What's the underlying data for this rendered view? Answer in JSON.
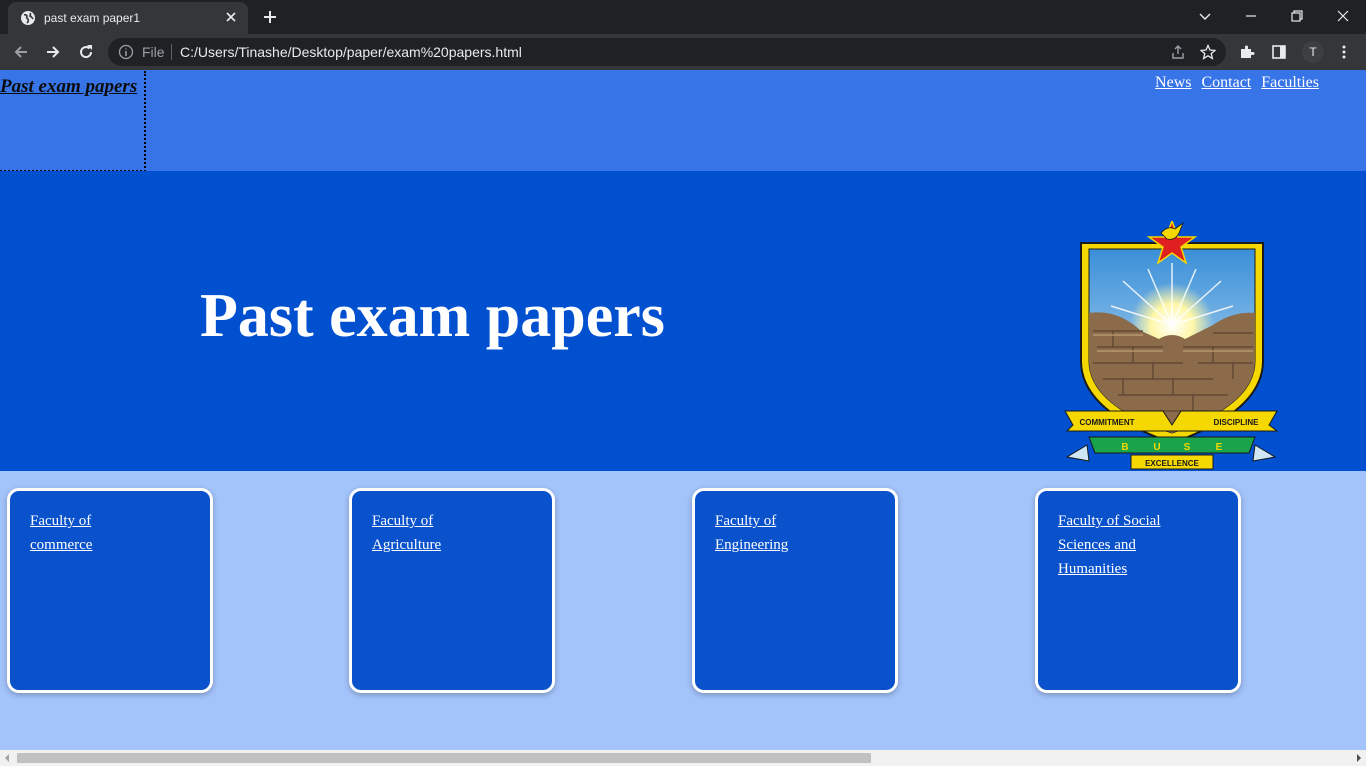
{
  "browser": {
    "tab_title": "past exam paper1",
    "omnibox_scheme": "File",
    "url": "C:/Users/Tinashe/Desktop/paper/exam%20papers.html",
    "profile_initial": "T"
  },
  "page": {
    "site_title_link": "Past exam papers",
    "nav": [
      "News",
      "Contact",
      "Faculties"
    ],
    "hero_title": "Past exam papers",
    "crest": {
      "banner_left": "COMMITMENT",
      "banner_right": "DISCIPLINE",
      "letters": [
        "B",
        "U",
        "S",
        "E"
      ],
      "motto": "EXCELLENCE"
    },
    "faculties": [
      {
        "lines": [
          "Faculty of",
          "commerce"
        ]
      },
      {
        "lines": [
          "Faculty of",
          "Agriculture"
        ]
      },
      {
        "lines": [
          "Faculty of",
          "Engineering"
        ]
      },
      {
        "lines": [
          "Faculty of Social",
          "Sciences and",
          "Humanities"
        ]
      }
    ]
  },
  "colors": {
    "topbar": "#3674e8",
    "hero": "#0050d0",
    "card": "#0a52cc",
    "page_bg": "#a3c3fb"
  }
}
